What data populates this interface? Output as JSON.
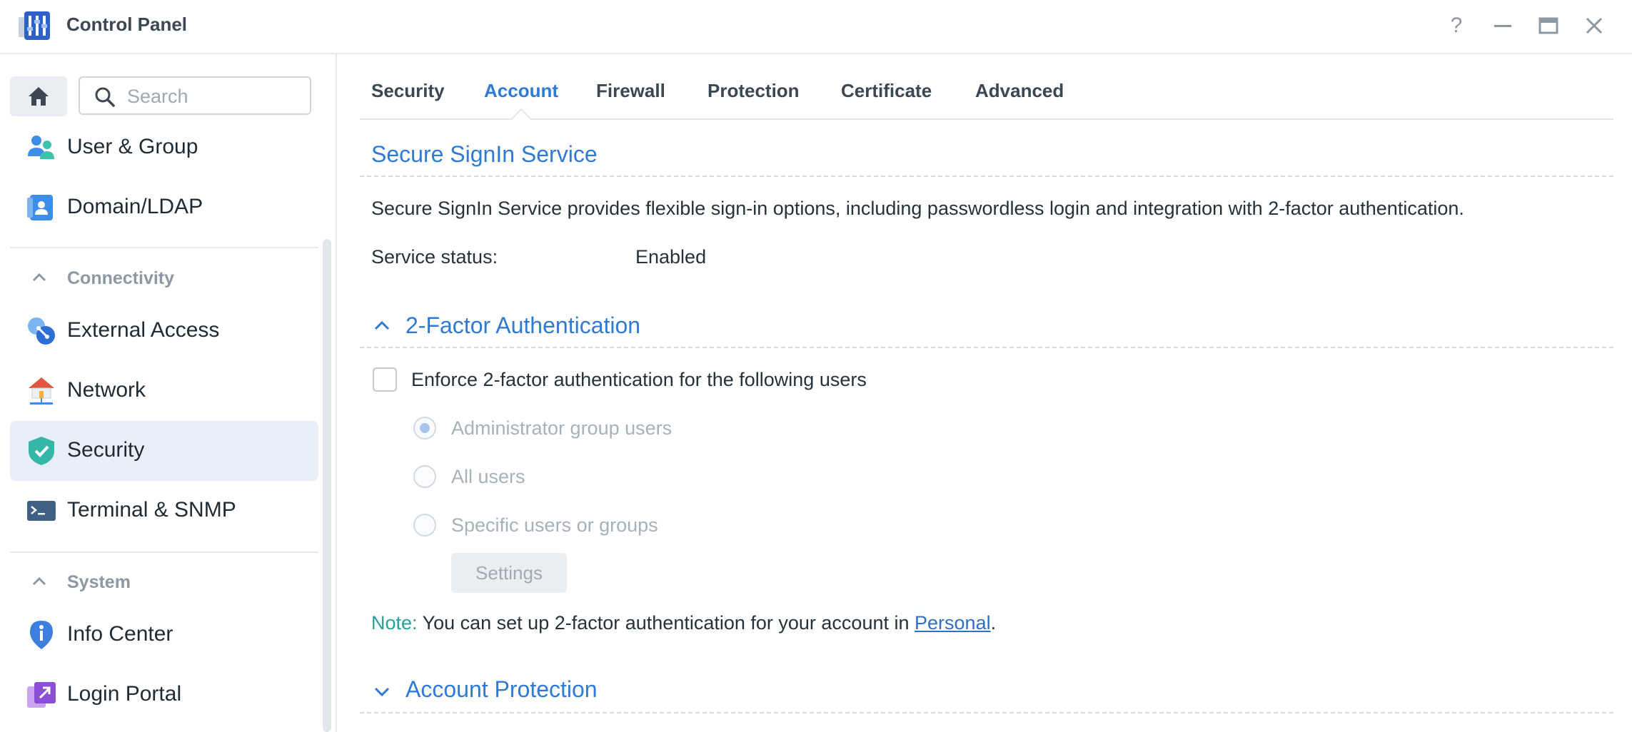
{
  "window": {
    "title": "Control Panel",
    "help_label": "?",
    "minimize_label": "—",
    "close_label": "✕"
  },
  "sidebar": {
    "search_placeholder": "Search",
    "items": [
      {
        "label": "User & Group",
        "icon": "user-group-icon"
      },
      {
        "label": "Domain/LDAP",
        "icon": "domain-ldap-icon"
      }
    ],
    "groups": [
      {
        "label": "Connectivity",
        "items": [
          {
            "label": "External Access",
            "icon": "external-access-icon"
          },
          {
            "label": "Network",
            "icon": "network-icon"
          },
          {
            "label": "Security",
            "icon": "security-shield-icon",
            "selected": true
          },
          {
            "label": "Terminal & SNMP",
            "icon": "terminal-icon"
          }
        ]
      },
      {
        "label": "System",
        "items": [
          {
            "label": "Info Center",
            "icon": "info-center-icon"
          },
          {
            "label": "Login Portal",
            "icon": "login-portal-icon"
          }
        ]
      }
    ]
  },
  "tabs": [
    {
      "label": "Security",
      "active": false
    },
    {
      "label": "Account",
      "active": true
    },
    {
      "label": "Firewall",
      "active": false
    },
    {
      "label": "Protection",
      "active": false
    },
    {
      "label": "Certificate",
      "active": false
    },
    {
      "label": "Advanced",
      "active": false
    }
  ],
  "secure_signin": {
    "title": "Secure SignIn Service",
    "description": "Secure SignIn Service provides flexible sign-in options, including passwordless login and integration with 2-factor authentication.",
    "status_label": "Service status:",
    "status_value": "Enabled"
  },
  "two_factor": {
    "title": "2-Factor Authentication",
    "expanded": true,
    "enforce_label": "Enforce 2-factor authentication for the following users",
    "enforce_checked": false,
    "options": [
      {
        "label": "Administrator group users",
        "checked": true
      },
      {
        "label": "All users",
        "checked": false
      },
      {
        "label": "Specific users or groups",
        "checked": false
      }
    ],
    "settings_button": "Settings",
    "note_label": "Note:",
    "note_text": "You can set up 2-factor authentication for your account in",
    "note_link": "Personal",
    "note_end": "."
  },
  "account_protection": {
    "title": "Account Protection",
    "expanded": false
  },
  "colors": {
    "accent": "#2f7ad6",
    "selected_bg": "#e8eff9",
    "note": "#2aa198"
  }
}
